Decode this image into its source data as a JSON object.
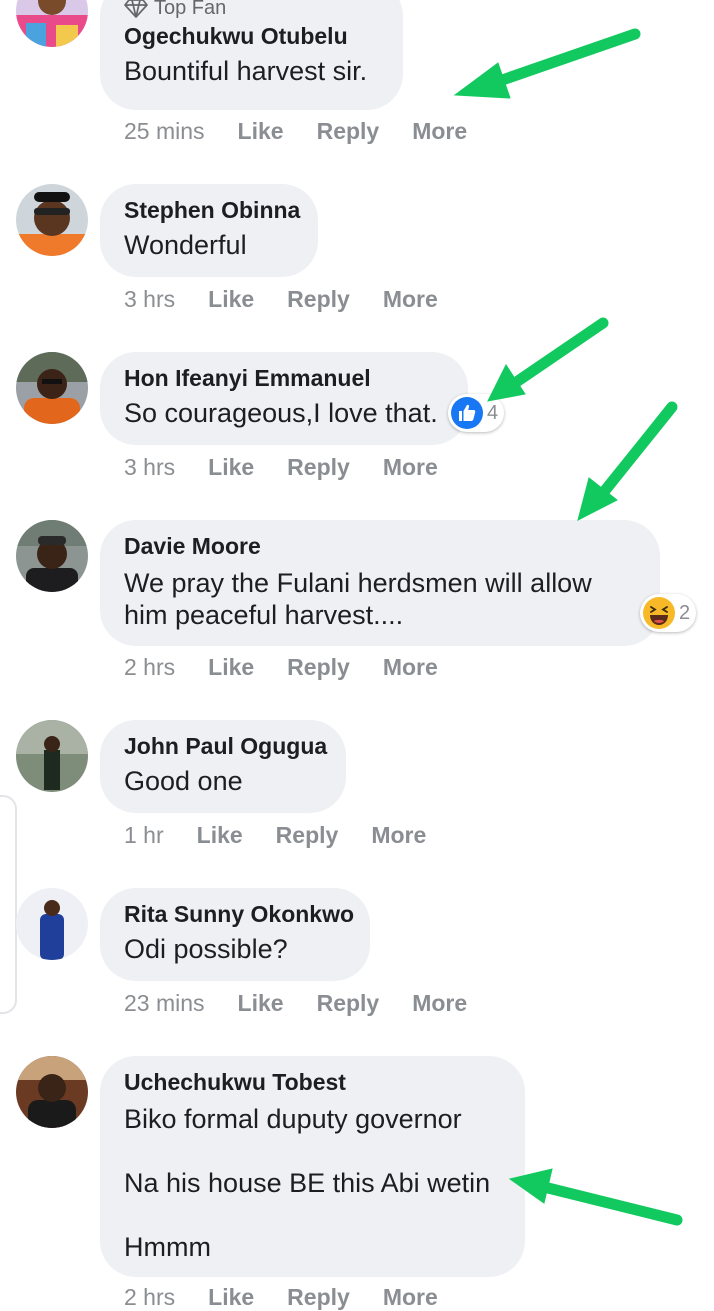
{
  "colors": {
    "bubble": "#eef0f3",
    "action": "#8a8d91",
    "arrow": "#12c95f",
    "like_blue": "#1877f2",
    "haha_yellow": "#f7b928"
  },
  "comments": [
    {
      "author": "Ogechukwu Otubelu",
      "badge": "Top Fan",
      "badge_icon": "diamond-icon",
      "text": "Bountiful harvest sir.",
      "time": "25 mins",
      "like": "Like",
      "reply": "Reply",
      "more": "More"
    },
    {
      "author": "Stephen Obinna",
      "text": "Wonderful",
      "time": "3 hrs",
      "like": "Like",
      "reply": "Reply",
      "more": "More"
    },
    {
      "author": "Hon Ifeanyi Emmanuel",
      "text": "So courageous,I love that.",
      "time": "3 hrs",
      "like": "Like",
      "reply": "Reply",
      "more": "More",
      "reaction": {
        "icon": "like-reaction-icon",
        "count": "4"
      }
    },
    {
      "author": "Davie Moore",
      "text_lines": [
        "We pray the Fulani herdsmen will allow",
        "him peaceful harvest...."
      ],
      "time": "2 hrs",
      "like": "Like",
      "reply": "Reply",
      "more": "More",
      "reaction": {
        "icon": "haha-reaction-icon",
        "count": "2"
      }
    },
    {
      "author": "John Paul Ogugua",
      "text": "Good one",
      "time": "1 hr",
      "like": "Like",
      "reply": "Reply",
      "more": "More"
    },
    {
      "author": "Rita Sunny Okonkwo",
      "text": "Odi possible?",
      "time": "23 mins",
      "like": "Like",
      "reply": "Reply",
      "more": "More"
    },
    {
      "author": "Uchechukwu Tobest",
      "text_lines": [
        "Biko formal duputy governor",
        "Na his house BE this Abi wetin",
        "Hmmm"
      ],
      "time": "2 hrs",
      "like": "Like",
      "reply": "Reply",
      "more": "More"
    }
  ]
}
